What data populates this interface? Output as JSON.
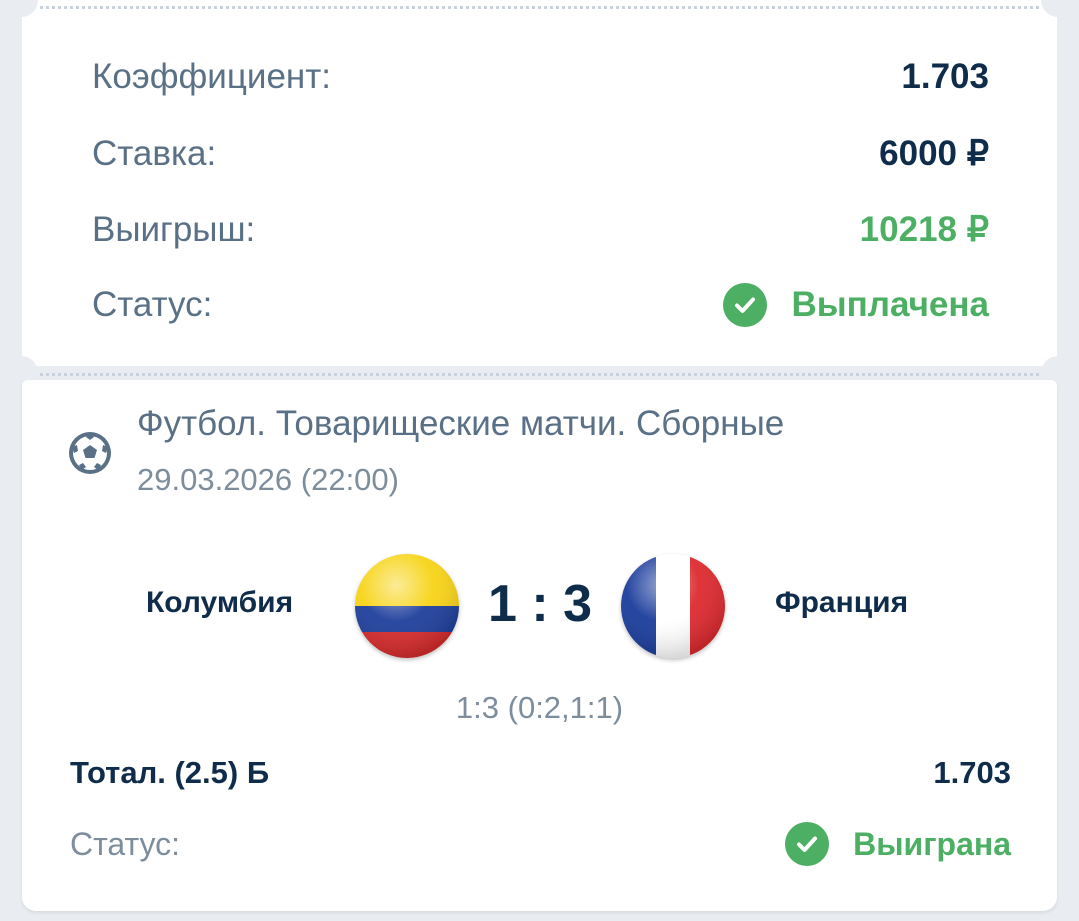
{
  "summary": {
    "coefficient_label": "Коэффициент:",
    "coefficient_value": "1.703",
    "stake_label": "Ставка:",
    "stake_value": "6000 ₽",
    "win_label": "Выигрыш:",
    "win_value": "10218 ₽",
    "status_label": "Статус:",
    "status_value": "Выплачена",
    "status_icon": "check-circle-icon"
  },
  "event": {
    "sport_icon": "soccer-ball-icon",
    "title": "Футбол. Товарищеские матчи. Сборные",
    "datetime": "29.03.2026 (22:00)",
    "home_team": "Колумбия",
    "away_team": "Франция",
    "score": "1 : 3",
    "periods": "1:3 (0:2,1:1)"
  },
  "bet": {
    "market": "Тотал. (2.5) Б",
    "coefficient": "1.703",
    "status_label": "Статус:",
    "status_value": "Выиграна",
    "status_icon": "check-circle-icon"
  },
  "colors": {
    "accent_green": "#4caf64",
    "text_dark": "#0f2c4b",
    "text_muted": "#5a7086",
    "background": "#e9edf1"
  }
}
